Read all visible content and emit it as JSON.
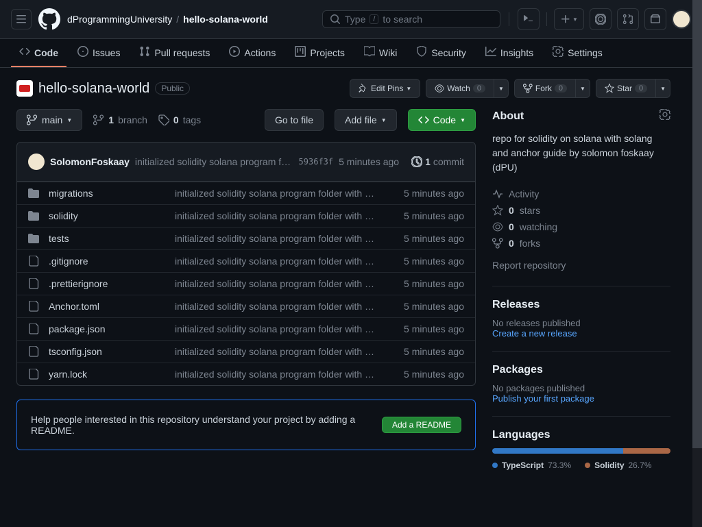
{
  "header": {
    "owner": "dProgrammingUniversity",
    "sep": "/",
    "repo": "hello-solana-world",
    "search_placeholder": "Type / to search"
  },
  "nav": {
    "code": "Code",
    "issues": "Issues",
    "pulls": "Pull requests",
    "actions": "Actions",
    "projects": "Projects",
    "wiki": "Wiki",
    "security": "Security",
    "insights": "Insights",
    "settings": "Settings"
  },
  "repo": {
    "name": "hello-solana-world",
    "visibility": "Public"
  },
  "actions": {
    "editpins": "Edit Pins",
    "watch": "Watch",
    "watch_count": "0",
    "fork": "Fork",
    "fork_count": "0",
    "star": "Star",
    "star_count": "0"
  },
  "filenav": {
    "branch": "main",
    "branches_count": "1",
    "branches_label": "branch",
    "tags_count": "0",
    "tags_label": "tags",
    "gotofile": "Go to file",
    "addfile": "Add file",
    "code": "Code"
  },
  "commit": {
    "author": "SolomonFoskaay",
    "message": "initialized solidity solana program folder with sol…",
    "hash": "5936f3f",
    "time": "5 minutes ago",
    "count": "1",
    "count_label": "commit"
  },
  "files": [
    {
      "type": "dir",
      "name": "migrations",
      "msg": "initialized solidity solana program folder with solang and a…",
      "time": "5 minutes ago"
    },
    {
      "type": "dir",
      "name": "solidity",
      "msg": "initialized solidity solana program folder with solang and a…",
      "time": "5 minutes ago"
    },
    {
      "type": "dir",
      "name": "tests",
      "msg": "initialized solidity solana program folder with solang and a…",
      "time": "5 minutes ago"
    },
    {
      "type": "file",
      "name": ".gitignore",
      "msg": "initialized solidity solana program folder with solang and a…",
      "time": "5 minutes ago"
    },
    {
      "type": "file",
      "name": ".prettierignore",
      "msg": "initialized solidity solana program folder with solang and a…",
      "time": "5 minutes ago"
    },
    {
      "type": "file",
      "name": "Anchor.toml",
      "msg": "initialized solidity solana program folder with solang and a…",
      "time": "5 minutes ago"
    },
    {
      "type": "file",
      "name": "package.json",
      "msg": "initialized solidity solana program folder with solang and a…",
      "time": "5 minutes ago"
    },
    {
      "type": "file",
      "name": "tsconfig.json",
      "msg": "initialized solidity solana program folder with solang and a…",
      "time": "5 minutes ago"
    },
    {
      "type": "file",
      "name": "yarn.lock",
      "msg": "initialized solidity solana program folder with solang and a…",
      "time": "5 minutes ago"
    }
  ],
  "readme": {
    "text": "Help people interested in this repository understand your project by adding a README.",
    "button": "Add a README"
  },
  "about": {
    "title": "About",
    "desc": "repo for solidity on solana with solang and anchor guide by solomon foskaay (dPU)",
    "activity": "Activity",
    "stars_count": "0",
    "stars_label": "stars",
    "watching_count": "0",
    "watching_label": "watching",
    "forks_count": "0",
    "forks_label": "forks",
    "report": "Report repository"
  },
  "releases": {
    "title": "Releases",
    "none": "No releases published",
    "create": "Create a new release"
  },
  "packages": {
    "title": "Packages",
    "none": "No packages published",
    "publish": "Publish your first package"
  },
  "languages": {
    "title": "Languages",
    "items": [
      {
        "name": "TypeScript",
        "pct": "73.3%",
        "color": "#3178c6",
        "width": "73.3%"
      },
      {
        "name": "Solidity",
        "pct": "26.7%",
        "color": "#aa6746",
        "width": "26.7%"
      }
    ]
  }
}
